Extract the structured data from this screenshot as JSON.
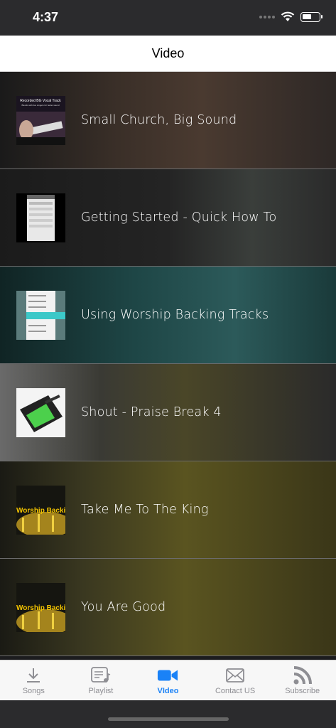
{
  "status_bar": {
    "time": "4:37",
    "battery_level": 0.55
  },
  "nav": {
    "title": "Video"
  },
  "videos": [
    {
      "title": "Small Church, Big Sound",
      "thumb_text": "Recorded BG Vocal Track",
      "thumb_subtext": "Blends with live singers for better sound",
      "bg_color": "#3a2f28"
    },
    {
      "title": "Getting Started - Quick How To",
      "bg_color": "#2a2a2a"
    },
    {
      "title": "Using Worship Backing Tracks",
      "bg_color": "#1e4a4a"
    },
    {
      "title": "Shout - Praise Break 4",
      "bg_color": "#3a3a33"
    },
    {
      "title": "Take Me To The King",
      "thumb_text": "Worship Backing T",
      "bg_color": "#4a4520"
    },
    {
      "title": "You Are Good",
      "thumb_text": "Worship Backing T",
      "bg_color": "#4a4520"
    }
  ],
  "tabs": [
    {
      "label": "Songs",
      "icon": "download-icon",
      "active": false
    },
    {
      "label": "Playlist",
      "icon": "playlist-icon",
      "active": false
    },
    {
      "label": "VIdeo",
      "icon": "video-camera-icon",
      "active": true
    },
    {
      "label": "Contact US",
      "icon": "envelope-icon",
      "active": false
    },
    {
      "label": "Subscribe",
      "icon": "rss-icon",
      "active": false
    }
  ],
  "colors": {
    "accent": "#1a82f7",
    "inactive": "#8e8e93"
  }
}
